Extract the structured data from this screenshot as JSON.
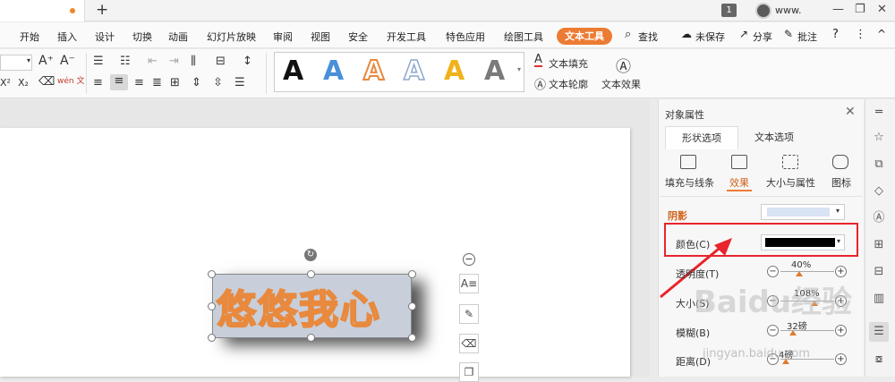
{
  "titlebar": {
    "new_tab": "+",
    "badge": "1",
    "user": "www.",
    "controls": [
      "—",
      "❐",
      "✕"
    ]
  },
  "menu": {
    "items": [
      "开始",
      "插入",
      "设计",
      "切换",
      "动画",
      "幻灯片放映",
      "审阅",
      "视图",
      "安全",
      "开发工具",
      "特色应用",
      "绘图工具"
    ],
    "active": "文本工具",
    "search": "查找",
    "unsaved": "未保存",
    "share": "分享",
    "comment": "批注",
    "help": "?",
    "more": "⋮",
    "collapse": "^"
  },
  "ribbon": {
    "increase_font": "A⁺",
    "decrease_font": "A⁻",
    "superscript": "X²",
    "subscript": "X₂",
    "clear": "⌫",
    "pinyin": "wén 文",
    "text_fill": "文本填充",
    "text_outline": "文本轮廓",
    "text_effect": "文本效果",
    "gallery_letter": "A",
    "gallery_colors": [
      "#111111",
      "#4a90d9",
      "#e8893e",
      "#8fa7cf",
      "#f0b21b",
      "#7a7a7a"
    ]
  },
  "canvas": {
    "text": "悠悠我心"
  },
  "panel": {
    "title": "对象属性",
    "tabs": [
      "形状选项",
      "文本选项"
    ],
    "subtabs": [
      "填充与线条",
      "效果",
      "大小与属性",
      "图标"
    ],
    "active_subtab": "效果",
    "section": "阴影",
    "color_label": "颜色(C)",
    "color_value": "#000000",
    "rows": [
      {
        "label": "透明度(T)",
        "value": "40%"
      },
      {
        "label": "大小(S)",
        "value": "108%"
      },
      {
        "label": "模糊(B)",
        "value": "32磅"
      },
      {
        "label": "距离(D)",
        "value": "4磅"
      }
    ]
  },
  "watermark": {
    "logo": "Baidu经验",
    "url": "jingyan.baidu.com"
  }
}
